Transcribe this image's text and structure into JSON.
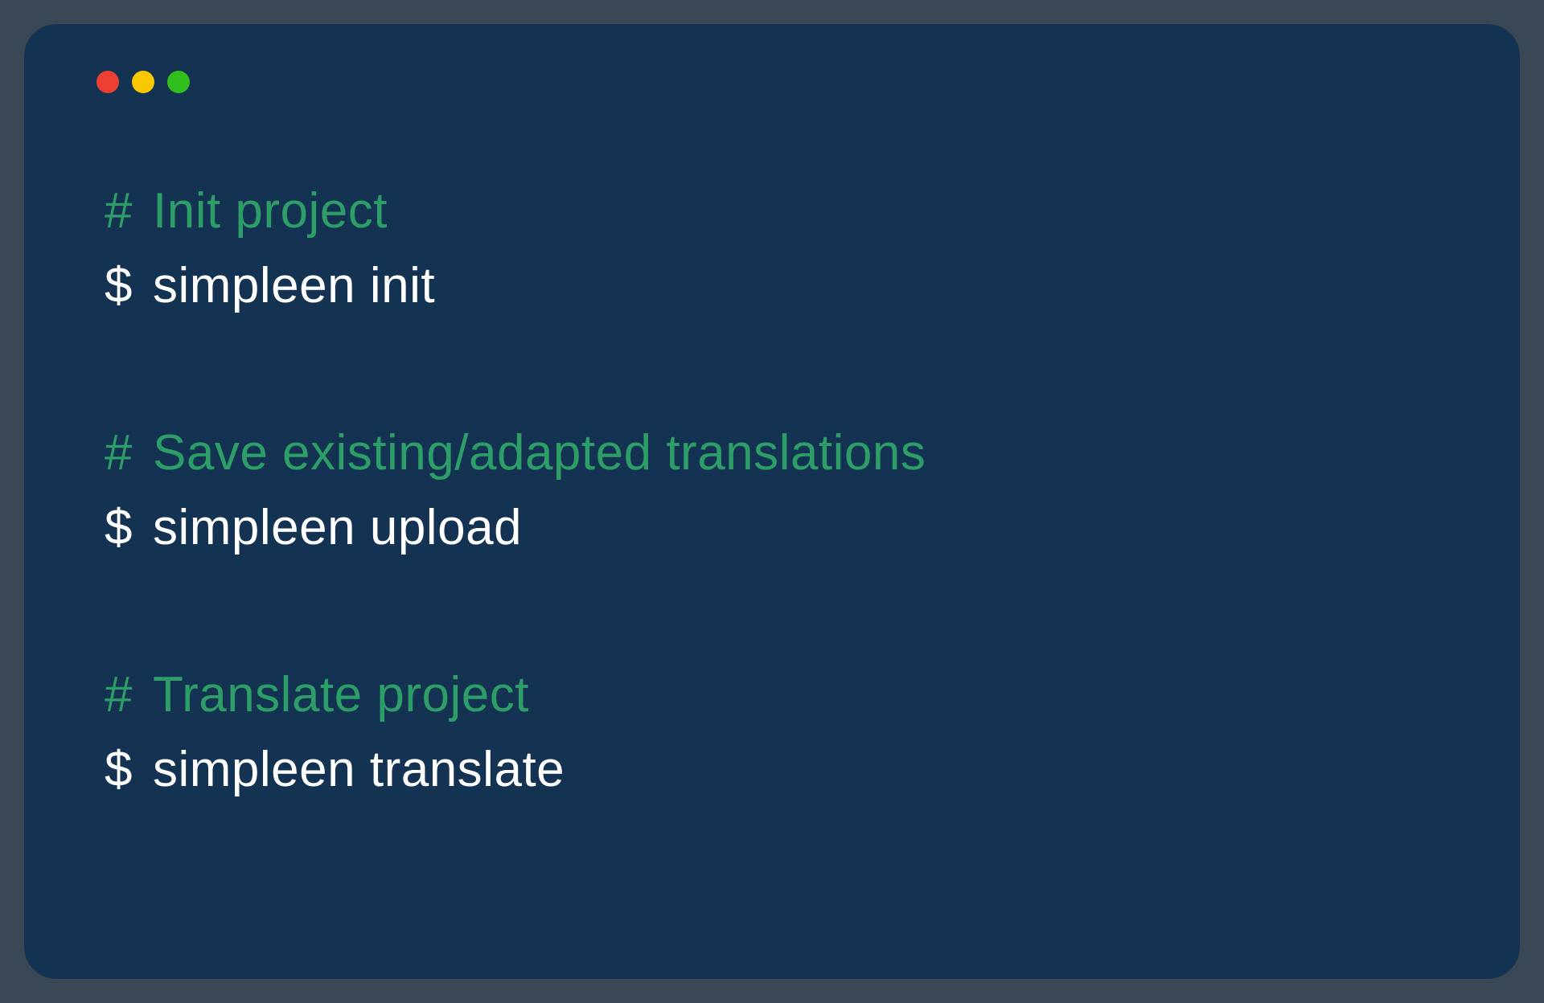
{
  "colors": {
    "background": "#3a4754",
    "terminal": "#143352",
    "comment": "#2e9e68",
    "command": "#ffffff",
    "traffic_red": "#ed3f32",
    "traffic_yellow": "#f9c800",
    "traffic_green": "#30bf1d"
  },
  "blocks": [
    {
      "comment_prefix": "#",
      "comment_text": "Init project",
      "command_prefix": "$",
      "command_text": "simpleen init"
    },
    {
      "comment_prefix": "#",
      "comment_text": "Save existing/adapted translations",
      "command_prefix": "$",
      "command_text": "simpleen upload"
    },
    {
      "comment_prefix": "#",
      "comment_text": "Translate project",
      "command_prefix": "$",
      "command_text": "simpleen translate"
    }
  ]
}
